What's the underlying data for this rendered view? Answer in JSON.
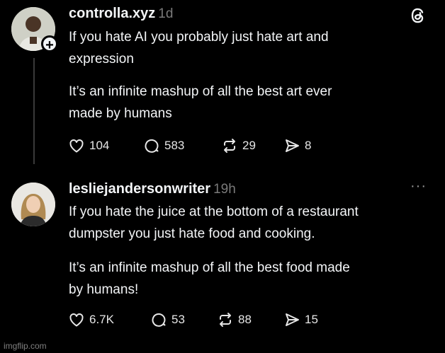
{
  "post1": {
    "username": "controlla.xyz",
    "time": "1d",
    "paragraph1_line1": "If you hate AI you probably just hate art and",
    "paragraph1_line2": "expression",
    "paragraph2_line1": "It’s an infinite mashup of all the best art ever",
    "paragraph2_line2": "made by humans",
    "likes": "104",
    "replies": "583",
    "reposts": "29",
    "shares": "8"
  },
  "post2": {
    "username": "lesliejandersonwriter",
    "time": "19h",
    "paragraph1_line1": "If you hate the juice at the bottom of a restaurant",
    "paragraph1_line2": "dumpster you just hate food and cooking.",
    "paragraph2_line1": "It’s an infinite mashup of all the best food made",
    "paragraph2_line2": "by humans!",
    "likes": "6.7K",
    "replies": "53",
    "reposts": "88",
    "shares": "15"
  },
  "more_menu": "···",
  "follow_badge": "+",
  "watermark": "imgflip.com",
  "icons": [
    "threads-logo-icon",
    "heart-icon",
    "comment-icon",
    "repost-icon",
    "share-icon",
    "more-icon",
    "plus-icon"
  ]
}
